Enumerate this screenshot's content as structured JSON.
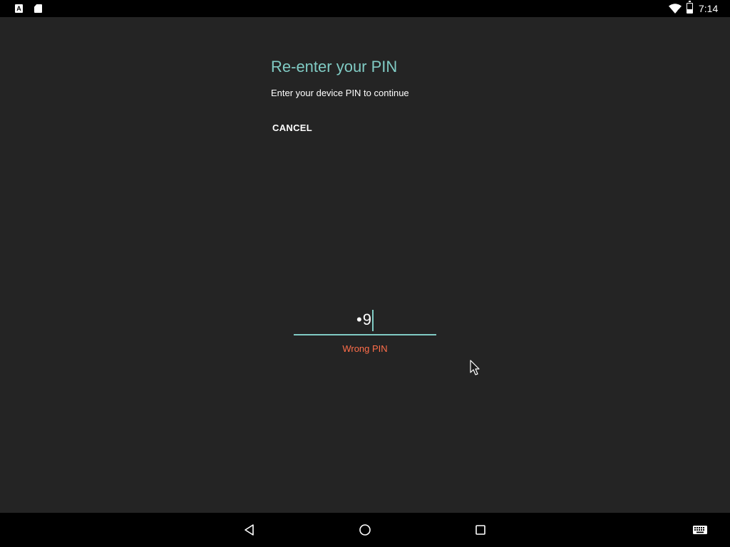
{
  "status_bar": {
    "time": "7:14",
    "left_icons": [
      "a-icon",
      "sd-card-icon"
    ],
    "right_icons": [
      "wifi-icon",
      "battery-icon"
    ]
  },
  "dialog": {
    "title": "Re-enter your PIN",
    "subtitle": "Enter your device PIN to continue",
    "cancel_label": "CANCEL"
  },
  "pin_input": {
    "value": "•9",
    "error": "Wrong PIN"
  },
  "nav_bar": {
    "buttons": [
      "back-icon",
      "home-icon",
      "recents-icon",
      "keyboard-icon"
    ]
  },
  "colors": {
    "accent": "#80cbc4",
    "error": "#ff6e4a",
    "background": "#242424",
    "bar": "#000000"
  }
}
